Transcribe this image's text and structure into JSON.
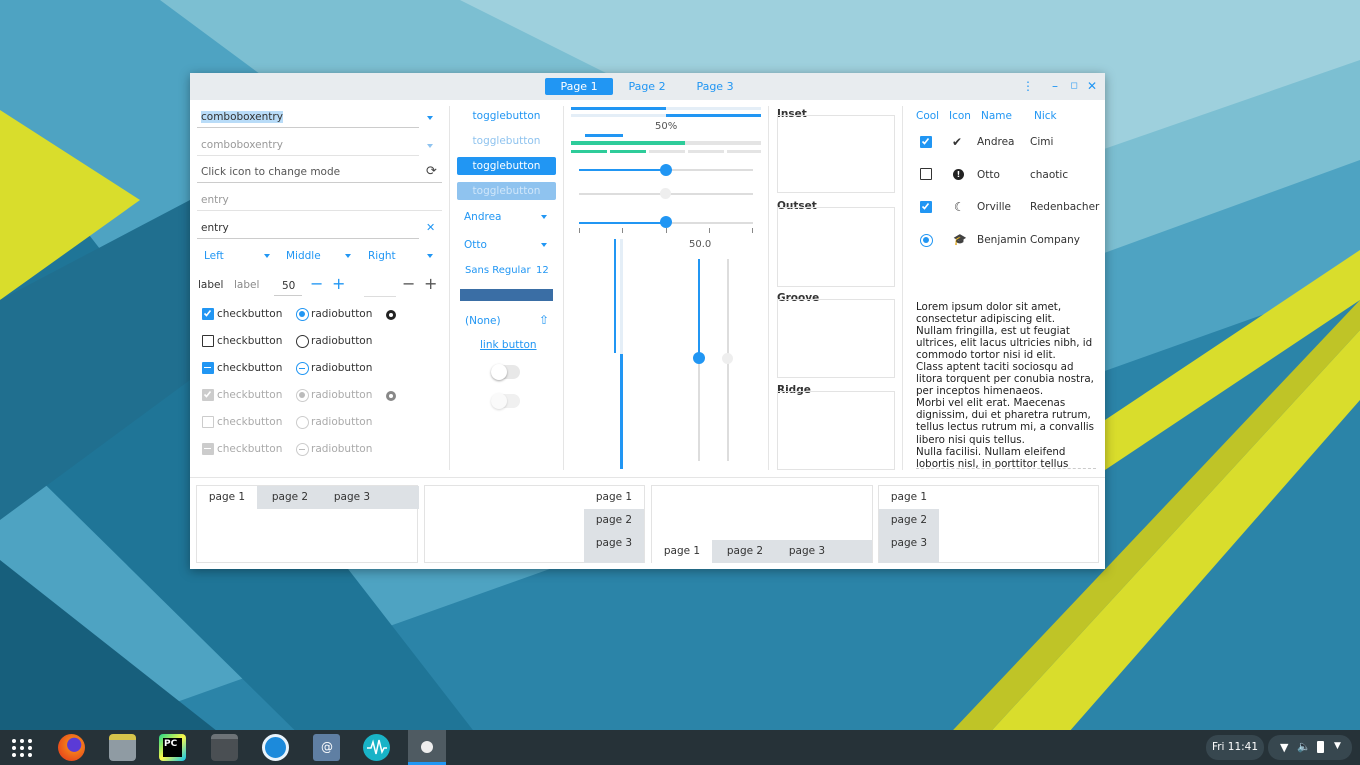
{
  "window": {
    "tabs": [
      "Page 1",
      "Page 2",
      "Page 3"
    ],
    "controls": {
      "menu_icon": "vertical-dots-icon",
      "minimize_icon": "minimize-icon",
      "maximize_icon": "maximize-icon",
      "close_icon": "close-icon"
    }
  },
  "col1": {
    "combo1": "comboboxentry",
    "combo2": "comboboxentry",
    "mode_entry": "Click icon to change mode",
    "entry_placeholder": "entry",
    "entry_value": "entry",
    "align": {
      "left": "Left",
      "middle": "Middle",
      "right": "Right"
    },
    "label1": "label",
    "label2": "label",
    "spin_value": "50",
    "checks": [
      {
        "label": "checkbutton",
        "state": "checked"
      },
      {
        "label": "checkbutton",
        "state": "unchecked"
      },
      {
        "label": "checkbutton",
        "state": "mixed"
      },
      {
        "label": "checkbutton",
        "state": "checked-disabled"
      },
      {
        "label": "checkbutton",
        "state": "unchecked-disabled"
      },
      {
        "label": "checkbutton",
        "state": "mixed-disabled"
      }
    ],
    "radios": [
      {
        "label": "radiobutton",
        "state": "checked"
      },
      {
        "label": "radiobutton",
        "state": "unchecked"
      },
      {
        "label": "radiobutton",
        "state": "mixed"
      },
      {
        "label": "radiobutton",
        "state": "checked-disabled"
      },
      {
        "label": "radiobutton",
        "state": "unchecked-disabled"
      },
      {
        "label": "radiobutton",
        "state": "mixed-disabled"
      }
    ]
  },
  "col2": {
    "toggles": [
      "togglebutton",
      "togglebutton",
      "togglebutton",
      "togglebutton"
    ],
    "combo_andrea": "Andrea",
    "combo_otto": "Otto",
    "font_name": "Sans Regular",
    "font_size": "12",
    "file_chooser": "(None)",
    "link": "link button"
  },
  "col3": {
    "progress_label": "50%",
    "progress_value": 0.5,
    "hscale_value": 0.5,
    "scale_label": "50.0",
    "vscale_value": 0.5
  },
  "frames": [
    "Inset",
    "Outset",
    "Groove",
    "Ridge"
  ],
  "tree": {
    "headers": [
      "Cool",
      "Icon",
      "Name",
      "Nick"
    ],
    "rows": [
      {
        "cool": "checked",
        "icon": "check-circle-icon",
        "name": "Andrea",
        "nick": "Cimi"
      },
      {
        "cool": "unchecked",
        "icon": "exclamation-circle-icon",
        "name": "Otto",
        "nick": "chaotic"
      },
      {
        "cool": "checked",
        "icon": "moon-icon",
        "name": "Orville",
        "nick": "Redenbacher"
      },
      {
        "cool": "radio",
        "icon": "hat-icon",
        "name": "Benjamin",
        "nick": "Company"
      }
    ]
  },
  "lorem": [
    "Lorem ipsum dolor sit amet,",
    "consectetur adipiscing elit.",
    "Nullam fringilla, est ut feugiat",
    "ultrices, elit lacus ultricies nibh, id",
    "commodo tortor nisi id elit.",
    "Class aptent taciti sociosqu ad",
    "litora torquent per conubia nostra,",
    "per inceptos himenaeos.",
    "Morbi vel elit erat. Maecenas",
    "dignissim, dui et pharetra rutrum,",
    "tellus lectus rutrum mi, a convallis",
    "libero nisi quis tellus.",
    "Nulla facilisi. Nullam eleifend",
    "lobortis nisl, in porttitor tellus"
  ],
  "notebooks": {
    "nb1": [
      "page 1",
      "page 2",
      "page 3"
    ],
    "nb2": [
      "page 1",
      "page 2",
      "page 3"
    ],
    "nb3": [
      "page 1",
      "page 2",
      "page 3"
    ],
    "nb4": [
      "page 1",
      "page 2",
      "page 3"
    ]
  },
  "taskbar": {
    "apps": [
      "app-grid-icon",
      "firefox-icon",
      "files-icon",
      "pycharm-icon",
      "terminal-icon",
      "timer-icon",
      "mail-icon",
      "audio-icon",
      "settings-icon"
    ],
    "clock": "Fri 11:41",
    "tray": [
      "wifi-icon",
      "volume-icon",
      "battery-icon",
      "tray-menu-icon"
    ]
  },
  "colors": {
    "accent": "#2196f3",
    "wallpaper_yellow": "#d9dd2c",
    "wallpaper_teal": "#2a8cb0"
  }
}
